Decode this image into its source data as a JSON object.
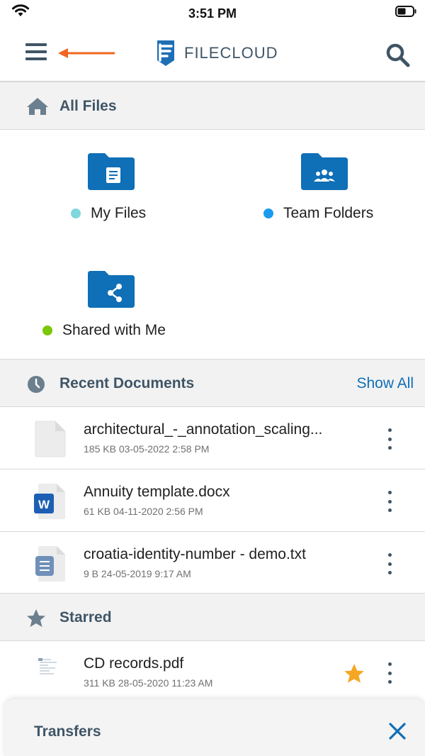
{
  "status_bar": {
    "time": "3:51 PM"
  },
  "header": {
    "brand_prefix": "FILE",
    "brand_suffix": "CLOUD"
  },
  "all_files": {
    "title": "All Files",
    "folders": [
      {
        "label": "My Files",
        "dot_color": "#7fd6dd",
        "icon": "document-folder-icon"
      },
      {
        "label": "Team Folders",
        "dot_color": "#1a9bf0",
        "icon": "team-folder-icon"
      },
      {
        "label": "Shared with Me",
        "dot_color": "#7ac70c",
        "icon": "share-folder-icon"
      }
    ]
  },
  "recent": {
    "title": "Recent Documents",
    "show_all": "Show All",
    "files": [
      {
        "name": "architectural_-_annotation_scaling...",
        "meta": "185 KB 03-05-2022 2:58 PM",
        "icon": "blank-file-icon"
      },
      {
        "name": "Annuity template.docx",
        "meta": "61 KB 04-11-2020 2:56 PM",
        "icon": "word-file-icon"
      },
      {
        "name": "croatia-identity-number - demo.txt",
        "meta": "9 B 24-05-2019 9:17 AM",
        "icon": "text-file-icon"
      }
    ]
  },
  "starred": {
    "title": "Starred",
    "files": [
      {
        "name": "CD records.pdf",
        "meta": "311 KB 28-05-2020 11:23 AM",
        "icon": "pdf-thumbnail-icon",
        "starred": true
      }
    ]
  },
  "transfers": {
    "title": "Transfers"
  },
  "colors": {
    "accent": "#0f6fb7",
    "header_text": "#3f5566",
    "folder": "#0f6fb7",
    "arrow": "#f26522",
    "star": "#f5a623"
  }
}
